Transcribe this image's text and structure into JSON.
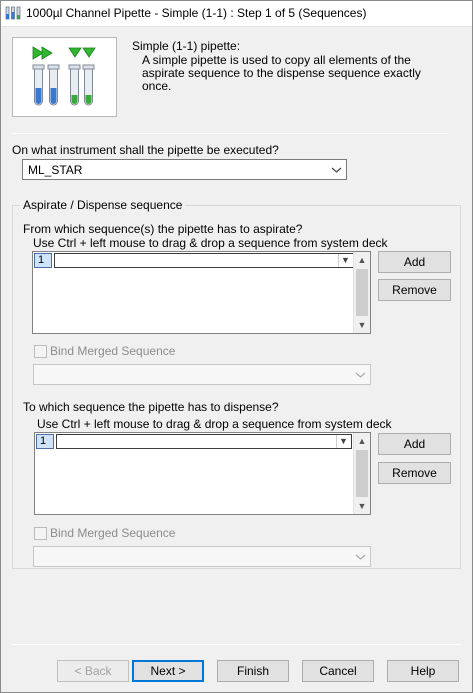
{
  "window": {
    "title": "1000µl Channel Pipette - Simple (1-1) : Step 1 of 5 (Sequences)"
  },
  "intro": {
    "title": "Simple (1-1) pipette:",
    "description": "A simple pipette is used to copy all elements of the aspirate sequence to the dispense sequence exactly once."
  },
  "instrument": {
    "question": "On what instrument shall the pipette be executed?",
    "selected": "ML_STAR"
  },
  "group": {
    "label": "Aspirate / Dispense sequence"
  },
  "aspirate": {
    "question": "From which sequence(s) the pipette has to aspirate?",
    "hint": "Use Ctrl + left mouse to drag & drop a sequence from system deck",
    "row_number": "1",
    "add_label": "Add",
    "remove_label": "Remove",
    "bind_label": "Bind Merged Sequence"
  },
  "dispense": {
    "question": "To which sequence the pipette has to dispense?",
    "hint": "Use Ctrl + left mouse to drag & drop a sequence from system deck",
    "row_number": "1",
    "add_label": "Add",
    "remove_label": "Remove",
    "bind_label": "Bind Merged Sequence"
  },
  "footer": {
    "back_label": "< Back",
    "next_label": "Next >",
    "finish_label": "Finish",
    "cancel_label": "Cancel",
    "help_label": "Help"
  },
  "colors": {
    "aspirate_liquid": "#3a78d0",
    "dispense_liquid": "#3aa83a",
    "arrow_green": "#2fb82f",
    "default_button_border": "#0078d7"
  },
  "icons": {
    "app": "pipette-tubes-icon",
    "dropdown": "chevron-down-icon"
  }
}
